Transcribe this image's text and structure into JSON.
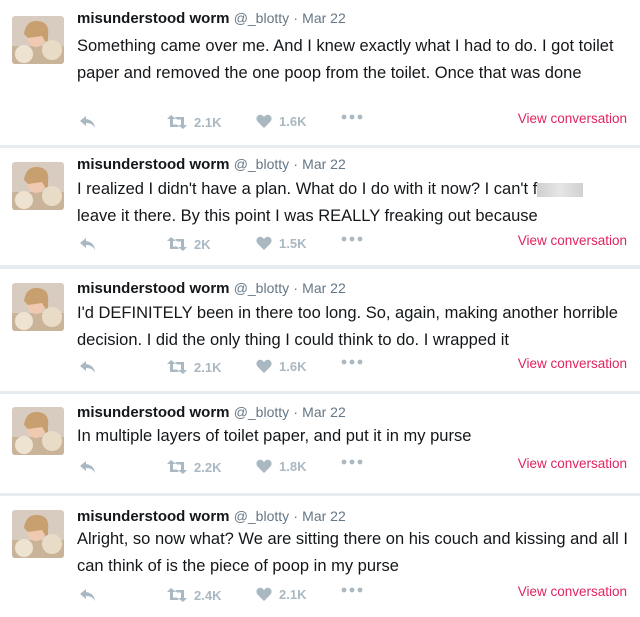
{
  "tweets": [
    {
      "name": "misunderstood worm",
      "handle": "@_blotty",
      "sep": "·",
      "date": "Mar 22",
      "text": "Something came over me. And I knew exactly what I had to do. I got toilet paper and removed the one poop from the toilet. Once that was done",
      "retweets": "2.1K",
      "likes": "1.6K",
      "view": "View conversation"
    },
    {
      "name": "misunderstood worm",
      "handle": "@_blotty",
      "sep": "·",
      "date": "Mar 22",
      "text": "I realized I didn't have a plan. What do I do with it now? I can't f",
      "text_after": " leave it there. By this point I was REALLY freaking out because",
      "retweets": "2K",
      "likes": "1.5K",
      "view": "View conversation"
    },
    {
      "name": "misunderstood worm",
      "handle": "@_blotty",
      "sep": "·",
      "date": "Mar 22",
      "text": "I'd DEFINITELY been in there too long. So, again, making another horrible decision. I did the only thing I could think to do. I wrapped it",
      "retweets": "2.1K",
      "likes": "1.6K",
      "view": "View conversation"
    },
    {
      "name": "misunderstood worm",
      "handle": "@_blotty",
      "sep": "·",
      "date": "Mar 22",
      "text": "In multiple layers of toilet paper, and put it in my purse",
      "retweets": "2.2K",
      "likes": "1.8K",
      "view": "View conversation"
    },
    {
      "name": "misunderstood worm",
      "handle": "@_blotty",
      "sep": "·",
      "date": "Mar 22",
      "text": "Alright, so now what? We are sitting there on his couch and kissing and all I can think of is the piece of poop in my purse",
      "retweets": "2.4K",
      "likes": "2.1K",
      "view": "View conversation"
    }
  ],
  "icons": {
    "reply": "reply-icon",
    "retweet": "retweet-icon",
    "like": "heart-icon",
    "more": "more-dots-icon"
  },
  "colors": {
    "accent": "#e0245e",
    "icon": "#aab8c2",
    "text": "#14171a",
    "muted": "#657786"
  }
}
